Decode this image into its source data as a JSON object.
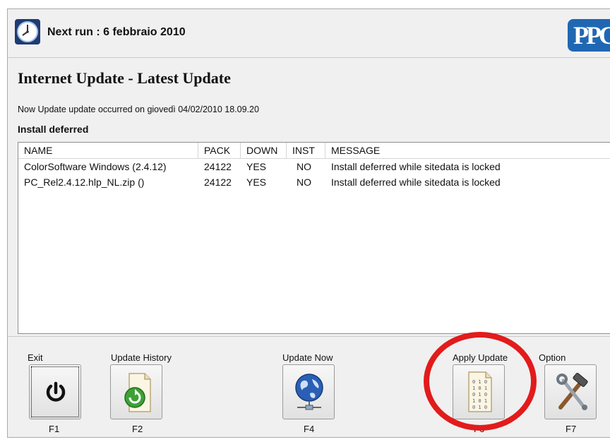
{
  "header": {
    "next_run": "Next run : 6 febbraio 2010",
    "logo_text": "PPG",
    "clock_icon": "clock-icon"
  },
  "page": {
    "title": "Internet Update - Latest Update",
    "notice": "Now Update update occurred on giovedì 04/02/2010 18.09.20",
    "status": "Install deferred"
  },
  "table": {
    "columns": [
      "NAME",
      "PACK",
      "DOWN",
      "INST",
      "MESSAGE"
    ],
    "rows": [
      [
        "ColorSoftware Windows (2.4.12)",
        "24122",
        "YES",
        "NO",
        "Install deferred while sitedata is locked"
      ],
      [
        "PC_Rel2.4.12.hlp_NL.zip ()",
        "24122",
        "YES",
        "NO",
        "Install deferred while sitedata is locked"
      ]
    ]
  },
  "toolbar": {
    "exit": {
      "label": "Exit",
      "key": "F1",
      "icon": "power-icon"
    },
    "history": {
      "label": "Update History",
      "key": "F2",
      "icon": "history-document-icon"
    },
    "update_now": {
      "label": "Update Now",
      "key": "F4",
      "icon": "globe-network-icon"
    },
    "apply": {
      "label": "Apply Update",
      "key": "F6",
      "icon": "binary-document-icon"
    },
    "option": {
      "label": "Option",
      "key": "F7",
      "icon": "tools-icon"
    }
  },
  "colors": {
    "highlight_ring": "#e21b1b",
    "logo_blue": "#2067b3"
  }
}
